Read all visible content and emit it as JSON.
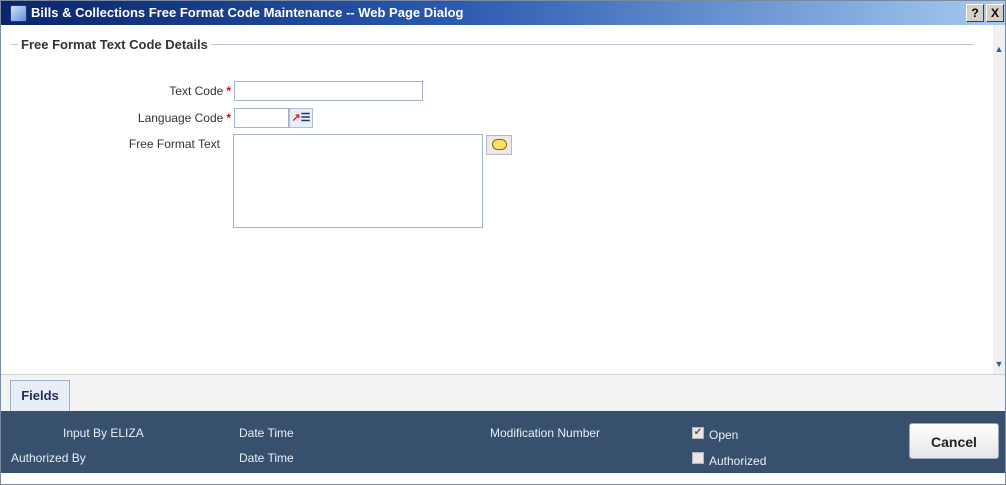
{
  "window": {
    "title": "Bills & Collections Free Format Code Maintenance -- Web Page Dialog",
    "help_label": "?",
    "close_label": "X"
  },
  "section": {
    "title": "Free Format Text Code Details"
  },
  "form": {
    "text_code": {
      "label": "Text Code",
      "required_mark": "*",
      "value": ""
    },
    "language_code": {
      "label": "Language Code",
      "required_mark": "*",
      "value": ""
    },
    "free_format_text": {
      "label": "Free Format Text",
      "value": ""
    }
  },
  "tabs": [
    {
      "label": "Fields"
    }
  ],
  "footer": {
    "input_by": "Input By ELIZA",
    "authorized_by": "Authorized By",
    "date_time_1": "Date Time",
    "date_time_2": "Date Time",
    "modification_number": "Modification Number",
    "open_label": "Open",
    "open_checked": true,
    "authorized_label": "Authorized",
    "authorized_checked": false,
    "cancel_label": "Cancel"
  },
  "colors": {
    "titlebar_start": "#0a246a",
    "footer_bg": "#37506e",
    "required": "#e00000"
  }
}
